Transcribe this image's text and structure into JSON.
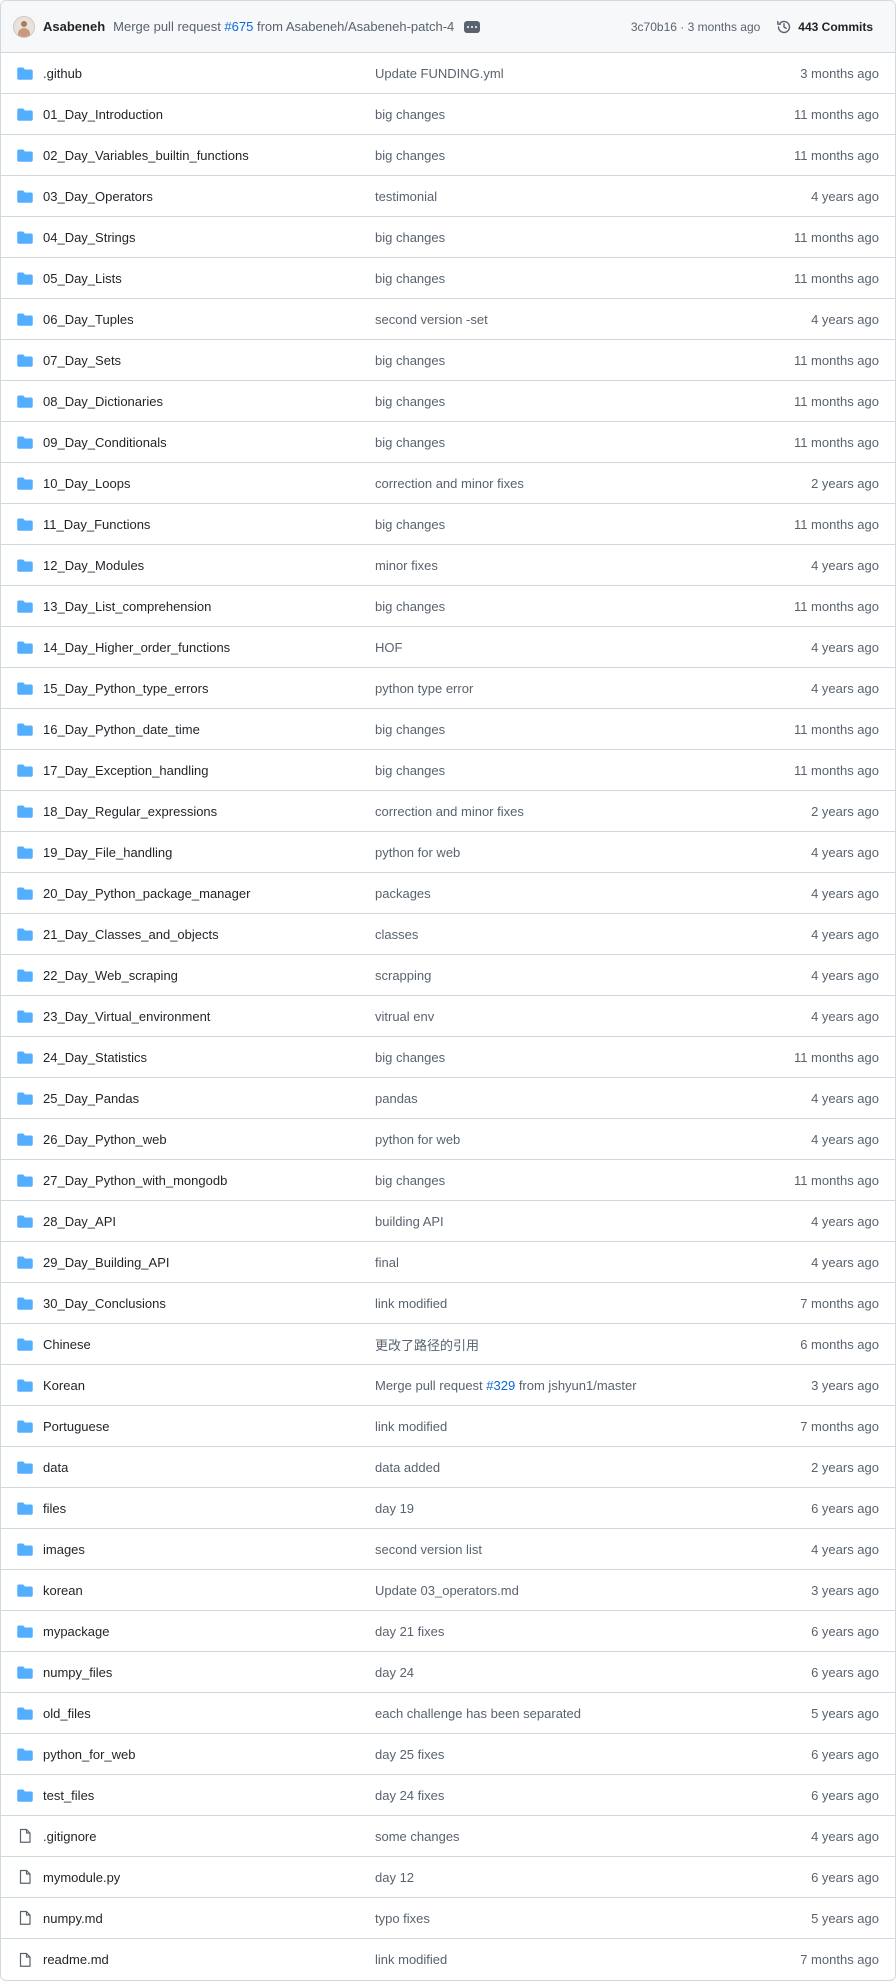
{
  "header": {
    "author": "Asabeneh",
    "message_prefix": "Merge pull request ",
    "message_link": "#675",
    "message_suffix": " from Asabeneh/Asabeneh-patch-4",
    "sha_time": "3c70b16 · 3 months ago",
    "commits": "443 Commits"
  },
  "rows": [
    {
      "type": "dir",
      "name": ".github",
      "msg": "Update FUNDING.yml",
      "date": "3 months ago"
    },
    {
      "type": "dir",
      "name": "01_Day_Introduction",
      "msg": "big changes",
      "date": "11 months ago"
    },
    {
      "type": "dir",
      "name": "02_Day_Variables_builtin_functions",
      "msg": "big changes",
      "date": "11 months ago"
    },
    {
      "type": "dir",
      "name": "03_Day_Operators",
      "msg": "testimonial",
      "date": "4 years ago"
    },
    {
      "type": "dir",
      "name": "04_Day_Strings",
      "msg": "big changes",
      "date": "11 months ago"
    },
    {
      "type": "dir",
      "name": "05_Day_Lists",
      "msg": "big changes",
      "date": "11 months ago"
    },
    {
      "type": "dir",
      "name": "06_Day_Tuples",
      "msg": "second version -set",
      "date": "4 years ago"
    },
    {
      "type": "dir",
      "name": "07_Day_Sets",
      "msg": "big changes",
      "date": "11 months ago"
    },
    {
      "type": "dir",
      "name": "08_Day_Dictionaries",
      "msg": "big changes",
      "date": "11 months ago"
    },
    {
      "type": "dir",
      "name": "09_Day_Conditionals",
      "msg": "big changes",
      "date": "11 months ago"
    },
    {
      "type": "dir",
      "name": "10_Day_Loops",
      "msg": "correction and minor fixes",
      "date": "2 years ago"
    },
    {
      "type": "dir",
      "name": "11_Day_Functions",
      "msg": "big changes",
      "date": "11 months ago"
    },
    {
      "type": "dir",
      "name": "12_Day_Modules",
      "msg": "minor fixes",
      "date": "4 years ago"
    },
    {
      "type": "dir",
      "name": "13_Day_List_comprehension",
      "msg": "big changes",
      "date": "11 months ago"
    },
    {
      "type": "dir",
      "name": "14_Day_Higher_order_functions",
      "msg": "HOF",
      "date": "4 years ago"
    },
    {
      "type": "dir",
      "name": "15_Day_Python_type_errors",
      "msg": "python type error",
      "date": "4 years ago"
    },
    {
      "type": "dir",
      "name": "16_Day_Python_date_time",
      "msg": "big changes",
      "date": "11 months ago"
    },
    {
      "type": "dir",
      "name": "17_Day_Exception_handling",
      "msg": "big changes",
      "date": "11 months ago"
    },
    {
      "type": "dir",
      "name": "18_Day_Regular_expressions",
      "msg": "correction and minor fixes",
      "date": "2 years ago"
    },
    {
      "type": "dir",
      "name": "19_Day_File_handling",
      "msg": "python for web",
      "date": "4 years ago"
    },
    {
      "type": "dir",
      "name": "20_Day_Python_package_manager",
      "msg": "packages",
      "date": "4 years ago"
    },
    {
      "type": "dir",
      "name": "21_Day_Classes_and_objects",
      "msg": "classes",
      "date": "4 years ago"
    },
    {
      "type": "dir",
      "name": "22_Day_Web_scraping",
      "msg": "scrapping",
      "date": "4 years ago"
    },
    {
      "type": "dir",
      "name": "23_Day_Virtual_environment",
      "msg": "vitrual env",
      "date": "4 years ago"
    },
    {
      "type": "dir",
      "name": "24_Day_Statistics",
      "msg": "big changes",
      "date": "11 months ago"
    },
    {
      "type": "dir",
      "name": "25_Day_Pandas",
      "msg": "pandas",
      "date": "4 years ago"
    },
    {
      "type": "dir",
      "name": "26_Day_Python_web",
      "msg": "python for web",
      "date": "4 years ago"
    },
    {
      "type": "dir",
      "name": "27_Day_Python_with_mongodb",
      "msg": "big changes",
      "date": "11 months ago"
    },
    {
      "type": "dir",
      "name": "28_Day_API",
      "msg": "building API",
      "date": "4 years ago"
    },
    {
      "type": "dir",
      "name": "29_Day_Building_API",
      "msg": "final",
      "date": "4 years ago"
    },
    {
      "type": "dir",
      "name": "30_Day_Conclusions",
      "msg": "link modified",
      "date": "7 months ago"
    },
    {
      "type": "dir",
      "name": "Chinese",
      "msg": "更改了路径的引用",
      "date": "6 months ago"
    },
    {
      "type": "dir",
      "name": "Korean",
      "msg": "Merge pull request ",
      "msg_link": "#329",
      "msg_suffix": " from jshyun1/master",
      "date": "3 years ago"
    },
    {
      "type": "dir",
      "name": "Portuguese",
      "msg": "link modified",
      "date": "7 months ago"
    },
    {
      "type": "dir",
      "name": "data",
      "msg": "data added",
      "date": "2 years ago"
    },
    {
      "type": "dir",
      "name": "files",
      "msg": "day 19",
      "date": "6 years ago"
    },
    {
      "type": "dir",
      "name": "images",
      "msg": "second version list",
      "date": "4 years ago"
    },
    {
      "type": "dir",
      "name": "korean",
      "msg": "Update 03_operators.md",
      "date": "3 years ago"
    },
    {
      "type": "dir",
      "name": "mypackage",
      "msg": "day 21 fixes",
      "date": "6 years ago"
    },
    {
      "type": "dir",
      "name": "numpy_files",
      "msg": "day 24",
      "date": "6 years ago"
    },
    {
      "type": "dir",
      "name": "old_files",
      "msg": "each challenge has been separated",
      "date": "5 years ago"
    },
    {
      "type": "dir",
      "name": "python_for_web",
      "msg": "day 25 fixes",
      "date": "6 years ago"
    },
    {
      "type": "dir",
      "name": "test_files",
      "msg": "day 24 fixes",
      "date": "6 years ago"
    },
    {
      "type": "file",
      "name": ".gitignore",
      "msg": "some changes",
      "date": "4 years ago"
    },
    {
      "type": "file",
      "name": "mymodule.py",
      "msg": "day 12",
      "date": "6 years ago"
    },
    {
      "type": "file",
      "name": "numpy.md",
      "msg": "typo fixes",
      "date": "5 years ago"
    },
    {
      "type": "file",
      "name": "readme.md",
      "msg": "link modified",
      "date": "7 months ago"
    }
  ],
  "colors": {
    "folder": "#54aeff",
    "file": "#59636e",
    "link": "#0969da",
    "muted": "#59636e",
    "border": "#d1d9e0"
  }
}
